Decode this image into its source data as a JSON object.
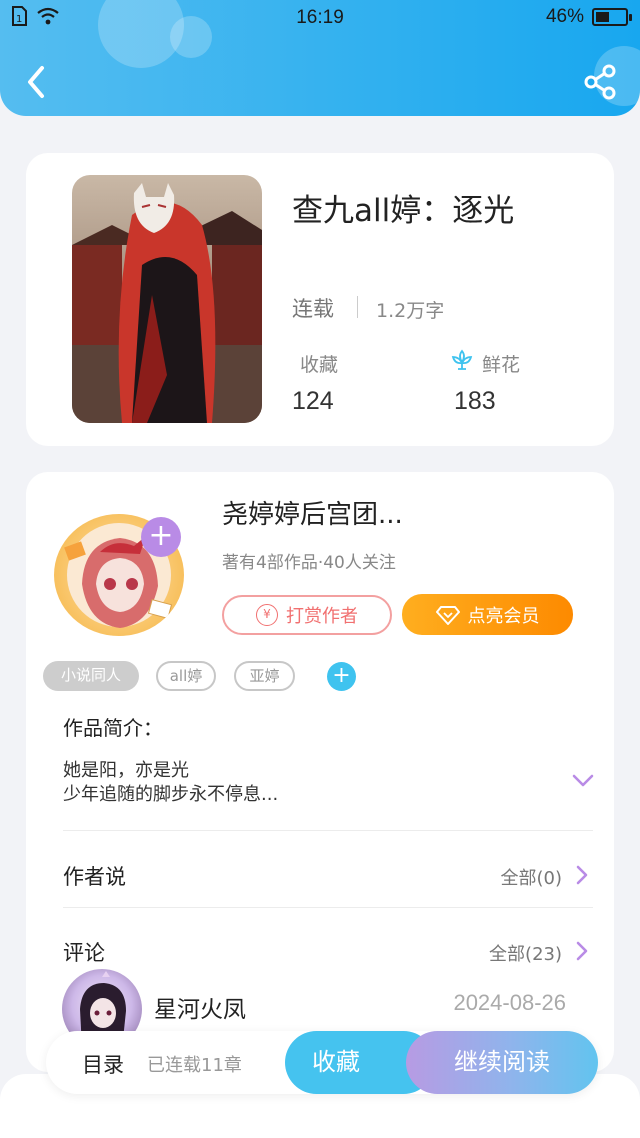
{
  "status_bar": {
    "time": "16:19",
    "battery": "46%",
    "battery_level": 0.46
  },
  "header": {
    "back_icon": "chevron-left-icon",
    "share_icon": "share-icon"
  },
  "book": {
    "title": "查九all婷：逐光",
    "status": "连载",
    "word_count": "1.2万字",
    "favorites_label": "收藏",
    "favorites_count": "124",
    "flowers_label": "鲜花",
    "flowers_count": "183"
  },
  "author": {
    "name": "尧婷婷后宫团...",
    "meta": "著有4部作品·40人关注",
    "tip_label": "打赏作者",
    "tip_icon_text": "¥",
    "vip_label": "点亮会员"
  },
  "tags": [
    "小说同人",
    "all婷",
    "亚婷"
  ],
  "intro": {
    "label": "作品简介：",
    "line1": "她是阳，亦是光",
    "line2": "少年追随的脚步永不停息..."
  },
  "author_says": {
    "label": "作者说",
    "more": "全部(0)"
  },
  "comments": {
    "label": "评论",
    "more": "全部(23)",
    "first": {
      "name": "星河火凤",
      "date": "2024-08-26"
    }
  },
  "bottom_bar": {
    "toc_label": "目录",
    "toc_count": "已连载11章",
    "fav_button": "收藏",
    "read_button": "继续阅读"
  },
  "colors": {
    "header": "#33b1ef",
    "accent_blue": "#45c3ef",
    "purple": "#b98be6",
    "orange": "#fd8a00",
    "pink": "#f17070"
  }
}
